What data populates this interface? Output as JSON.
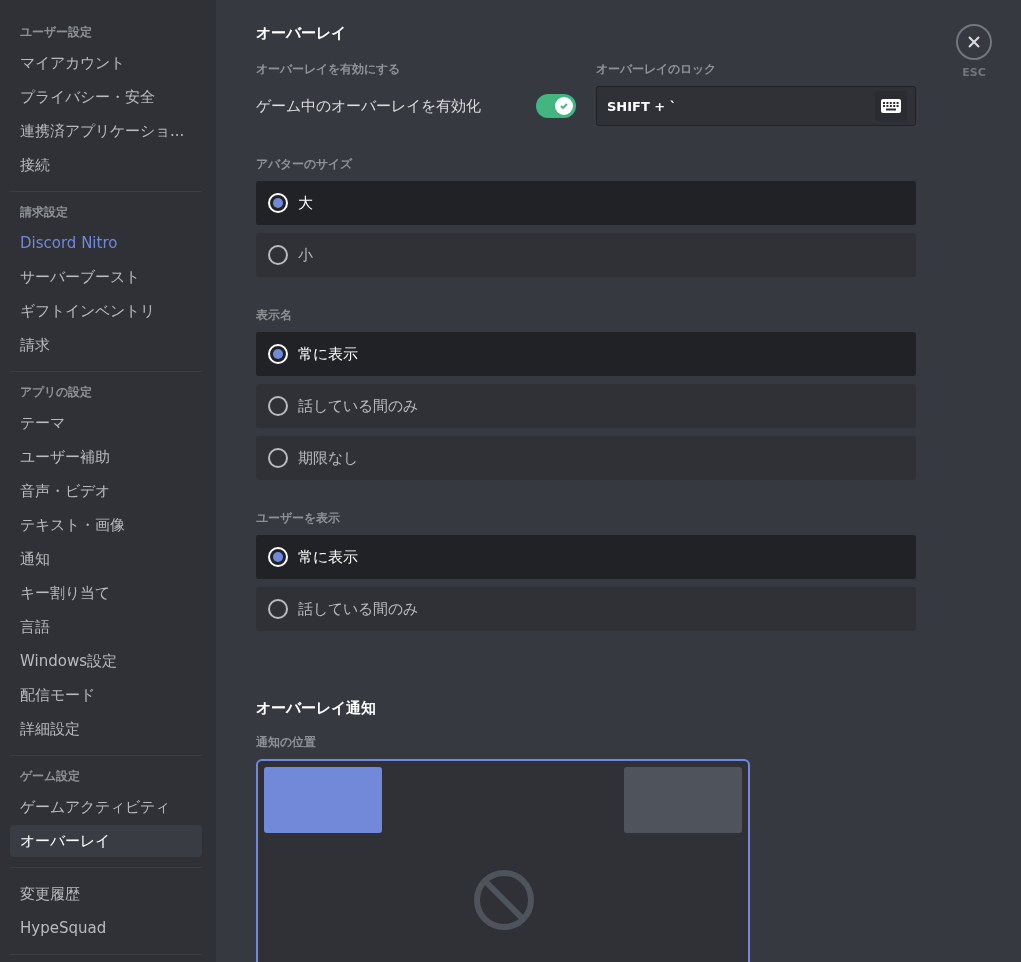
{
  "sidebar": {
    "sections": [
      {
        "header": "ユーザー設定",
        "items": [
          {
            "label": "マイアカウント",
            "kind": "normal",
            "selected": false
          },
          {
            "label": "プライバシー・安全",
            "kind": "normal",
            "selected": false
          },
          {
            "label": "連携済アプリケーショ...",
            "kind": "normal",
            "selected": false
          },
          {
            "label": "接続",
            "kind": "normal",
            "selected": false
          }
        ]
      },
      {
        "header": "請求設定",
        "items": [
          {
            "label": "Discord Nitro",
            "kind": "nitro",
            "selected": false
          },
          {
            "label": "サーバーブースト",
            "kind": "normal",
            "selected": false
          },
          {
            "label": "ギフトインベントリ",
            "kind": "normal",
            "selected": false
          },
          {
            "label": "請求",
            "kind": "normal",
            "selected": false
          }
        ]
      },
      {
        "header": "アプリの設定",
        "items": [
          {
            "label": "テーマ",
            "kind": "normal",
            "selected": false
          },
          {
            "label": "ユーザー補助",
            "kind": "normal",
            "selected": false
          },
          {
            "label": "音声・ビデオ",
            "kind": "normal",
            "selected": false
          },
          {
            "label": "テキスト・画像",
            "kind": "normal",
            "selected": false
          },
          {
            "label": "通知",
            "kind": "normal",
            "selected": false
          },
          {
            "label": "キー割り当て",
            "kind": "normal",
            "selected": false
          },
          {
            "label": "言語",
            "kind": "normal",
            "selected": false
          },
          {
            "label": "Windows設定",
            "kind": "normal",
            "selected": false
          },
          {
            "label": "配信モード",
            "kind": "normal",
            "selected": false
          },
          {
            "label": "詳細設定",
            "kind": "normal",
            "selected": false
          }
        ]
      },
      {
        "header": "ゲーム設定",
        "items": [
          {
            "label": "ゲームアクティビティ",
            "kind": "normal",
            "selected": false
          },
          {
            "label": "オーバーレイ",
            "kind": "normal",
            "selected": true
          }
        ]
      },
      {
        "items": [
          {
            "label": "変更履歴",
            "kind": "normal",
            "selected": false
          },
          {
            "label": "HypeSquad",
            "kind": "normal",
            "selected": false
          }
        ]
      }
    ]
  },
  "main": {
    "title": "オーバーレイ",
    "enable": {
      "label": "オーバーレイを有効にする",
      "toggle_label": "ゲーム中のオーバーレイを有効化",
      "on": true
    },
    "lock": {
      "label": "オーバーレイのロック",
      "value": "SHIFT + `"
    },
    "radio_groups": [
      {
        "label": "アバターのサイズ",
        "options": [
          {
            "label": "大",
            "selected": true
          },
          {
            "label": "小",
            "selected": false
          }
        ]
      },
      {
        "label": "表示名",
        "options": [
          {
            "label": "常に表示",
            "selected": true
          },
          {
            "label": "話している間のみ",
            "selected": false
          },
          {
            "label": "期限なし",
            "selected": false
          }
        ]
      },
      {
        "label": "ユーザーを表示",
        "options": [
          {
            "label": "常に表示",
            "selected": true
          },
          {
            "label": "話している間のみ",
            "selected": false
          }
        ]
      }
    ],
    "notifications": {
      "title": "オーバーレイ通知",
      "position_label": "通知の位置",
      "positions": [
        {
          "kind": "top-left",
          "selected": true
        },
        {
          "kind": "top-right",
          "selected": false
        }
      ]
    }
  },
  "close": {
    "label": "ESC"
  }
}
